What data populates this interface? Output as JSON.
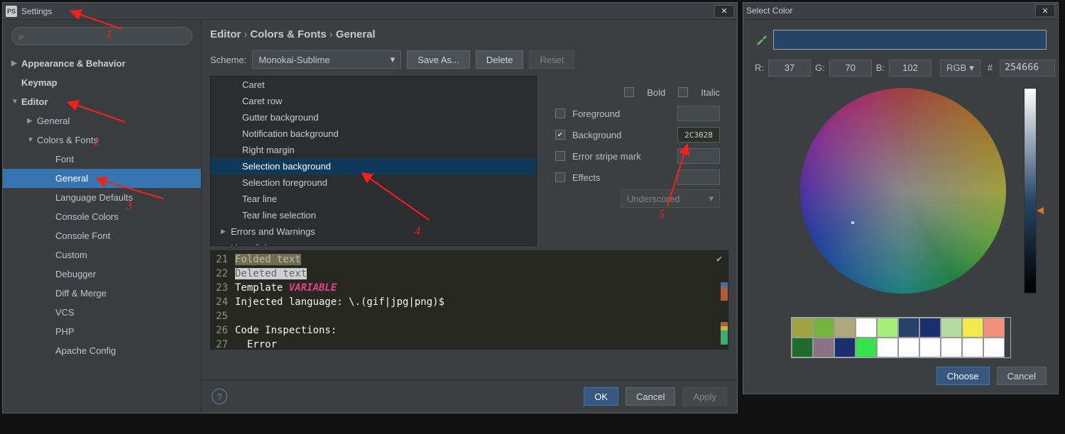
{
  "settings": {
    "title": "Settings",
    "ps_label": "PS",
    "breadcrumb": [
      "Editor",
      "Colors & Fonts",
      "General"
    ],
    "scheme_label": "Scheme:",
    "scheme_value": "Monokai-Sublime",
    "save_as_label": "Save As...",
    "delete_label": "Delete",
    "reset_label": "Reset",
    "sidebar": {
      "top": [
        {
          "label": "Appearance & Behavior",
          "chev": "closed",
          "bold": true
        },
        {
          "label": "Keymap",
          "chev": "none",
          "bold": true
        },
        {
          "label": "Editor",
          "chev": "open",
          "bold": true
        }
      ],
      "editor": [
        {
          "label": "General",
          "chev": "closed",
          "ind": 1
        },
        {
          "label": "Colors & Fonts",
          "chev": "open",
          "ind": 1
        },
        {
          "label": "Font",
          "ind": 2
        },
        {
          "label": "General",
          "ind": 2,
          "selected": true
        },
        {
          "label": "Language Defaults",
          "ind": 2
        },
        {
          "label": "Console Colors",
          "ind": 2
        },
        {
          "label": "Console Font",
          "ind": 2
        },
        {
          "label": "Custom",
          "ind": 2
        },
        {
          "label": "Debugger",
          "ind": 2
        },
        {
          "label": "Diff & Merge",
          "ind": 2
        },
        {
          "label": "VCS",
          "ind": 2
        },
        {
          "label": "PHP",
          "ind": 2
        },
        {
          "label": "Apache Config",
          "ind": 2
        }
      ]
    },
    "items": {
      "children": [
        "Caret",
        "Caret row",
        "Gutter background",
        "Notification background",
        "Right margin",
        "Selection background",
        "Selection foreground",
        "Tear line",
        "Tear line selection"
      ],
      "selected_index": 5,
      "after": [
        {
          "label": "Errors and Warnings",
          "chev": "closed"
        },
        {
          "label": "Hyperlinks",
          "chev": "closed"
        }
      ]
    },
    "attrs": {
      "bold": "Bold",
      "italic": "Italic",
      "foreground": "Foreground",
      "background": "Background",
      "background_value": "2C3028",
      "error_stripe": "Error stripe mark",
      "effects": "Effects",
      "effects_type": "Underscored"
    },
    "preview": {
      "lines": [
        "21",
        "22",
        "23",
        "24",
        "25",
        "26",
        "27"
      ],
      "l21": "Folded text",
      "l22": "Deleted text",
      "l23a": "Template ",
      "l23b": "VARIABLE",
      "l24": "Injected language: \\.(gif|jpg|png)$",
      "l25": "",
      "l26": "Code Inspections:",
      "l27": "  Error"
    },
    "footer": {
      "ok": "OK",
      "cancel": "Cancel",
      "apply": "Apply",
      "help": "?"
    }
  },
  "color": {
    "title": "Select Color",
    "r_label": "R:",
    "r": "37",
    "g_label": "G:",
    "g": "70",
    "b_label": "B:",
    "b": "102",
    "mode": "RGB",
    "hex": "254666",
    "choose": "Choose",
    "cancel": "Cancel",
    "palette": [
      "#a2a33f",
      "#77b23d",
      "#b0a87a",
      "#fdfdfd",
      "#a6f07a",
      "#24426c",
      "#1b2e6f",
      "#b4dca0",
      "#f4e84a",
      "#f29078",
      "#1e6b2c",
      "#8a7283",
      "#1b2e6f",
      "#36e24a",
      "#fdfdfd",
      "#fdfdfd",
      "#fdfdfd",
      "#fdfdfd",
      "#fdfdfd",
      "#fdfdfd"
    ]
  },
  "annotations": {
    "n1": "1",
    "n2": "2",
    "n3": "3",
    "n4": "4",
    "n5": "5"
  }
}
